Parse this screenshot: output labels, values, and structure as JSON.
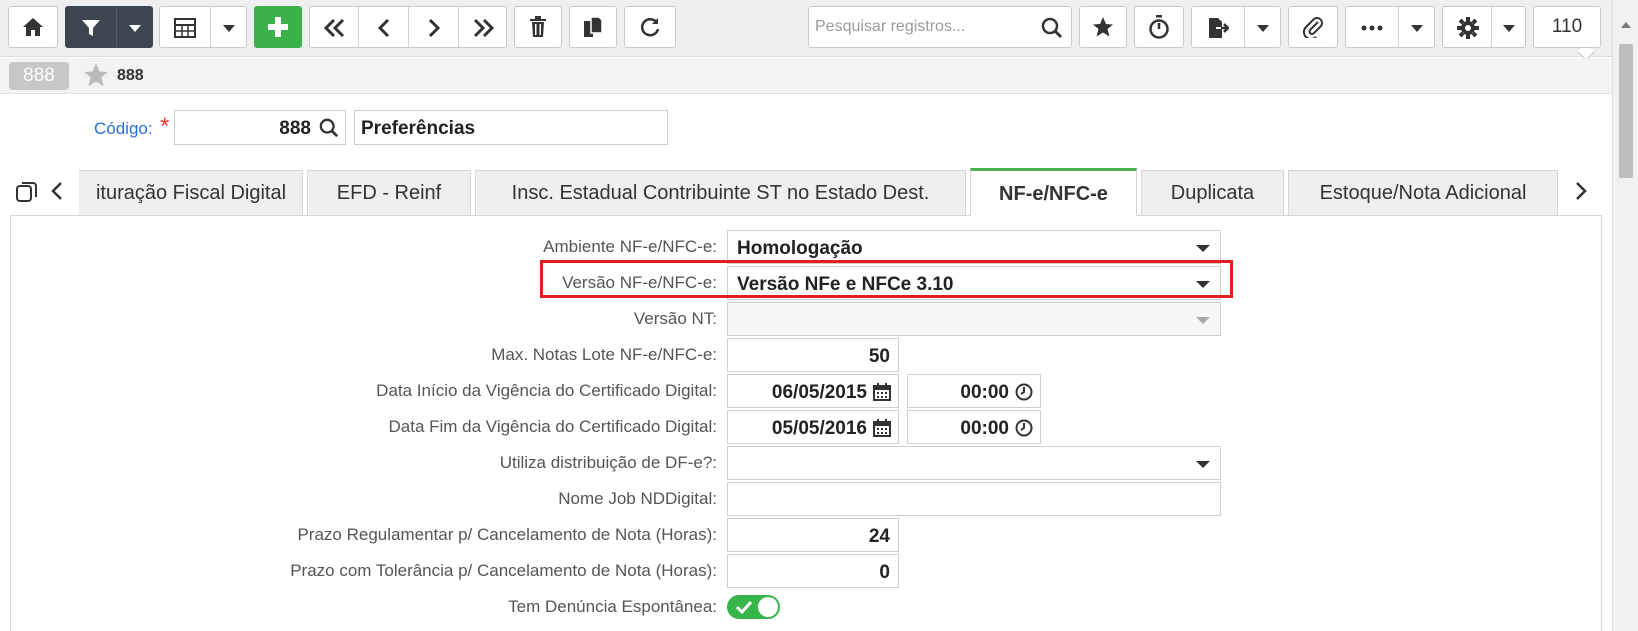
{
  "toolbar": {
    "search_placeholder": "Pesquisar registros...",
    "record_count": "110",
    "buttons": [
      "home-icon",
      "filter-icon",
      "grid-icon",
      "add-icon",
      "first-icon",
      "prev-icon",
      "next-icon",
      "last-icon",
      "delete-icon",
      "copy-icon",
      "refresh-icon",
      "star-icon",
      "timer-icon",
      "export-icon",
      "attach-icon",
      "more-icon",
      "gear-icon"
    ]
  },
  "record": {
    "badge": "888",
    "title": "888"
  },
  "codigo": {
    "label": "Código:",
    "required_mark": "*",
    "value": "888",
    "description": "Preferências"
  },
  "tabs": [
    {
      "label": "ituração Fiscal Digital"
    },
    {
      "label": "EFD - Reinf"
    },
    {
      "label": "Insc. Estadual Contribuinte ST no Estado Dest."
    },
    {
      "label": "NF-e/NFC-e",
      "active": true
    },
    {
      "label": "Duplicata"
    },
    {
      "label": "Estoque/Nota Adicional"
    }
  ],
  "form": {
    "ambiente": {
      "label": "Ambiente NF-e/NFC-e:",
      "value": "Homologação"
    },
    "versao": {
      "label": "Versão NF-e/NFC-e:",
      "value": "Versão NFe e NFCe 3.10"
    },
    "versao_nt": {
      "label": "Versão NT:",
      "value": ""
    },
    "max_notas": {
      "label": "Max. Notas Lote NF-e/NFC-e:",
      "value": "50"
    },
    "data_inicio": {
      "label": "Data Início da Vigência do Certificado Digital:",
      "date": "06/05/2015",
      "time": "00:00"
    },
    "data_fim": {
      "label": "Data Fim da Vigência do Certificado Digital:",
      "date": "05/05/2016",
      "time": "00:00"
    },
    "distribuicao": {
      "label": "Utiliza distribuição de DF-e?:",
      "value": ""
    },
    "nome_job": {
      "label": "Nome Job NDDigital:",
      "value": ""
    },
    "prazo_reg": {
      "label": "Prazo Regulamentar p/ Cancelamento de Nota (Horas):",
      "value": "24"
    },
    "prazo_tol": {
      "label": "Prazo com Tolerância p/ Cancelamento de Nota (Horas):",
      "value": "0"
    },
    "denuncia": {
      "label": "Tem Denúncia Espontânea:",
      "checked": true
    }
  },
  "colors": {
    "accent_green": "#3cb34a",
    "label_blue": "#2a6fd6",
    "highlight_red": "#e41e1e"
  }
}
